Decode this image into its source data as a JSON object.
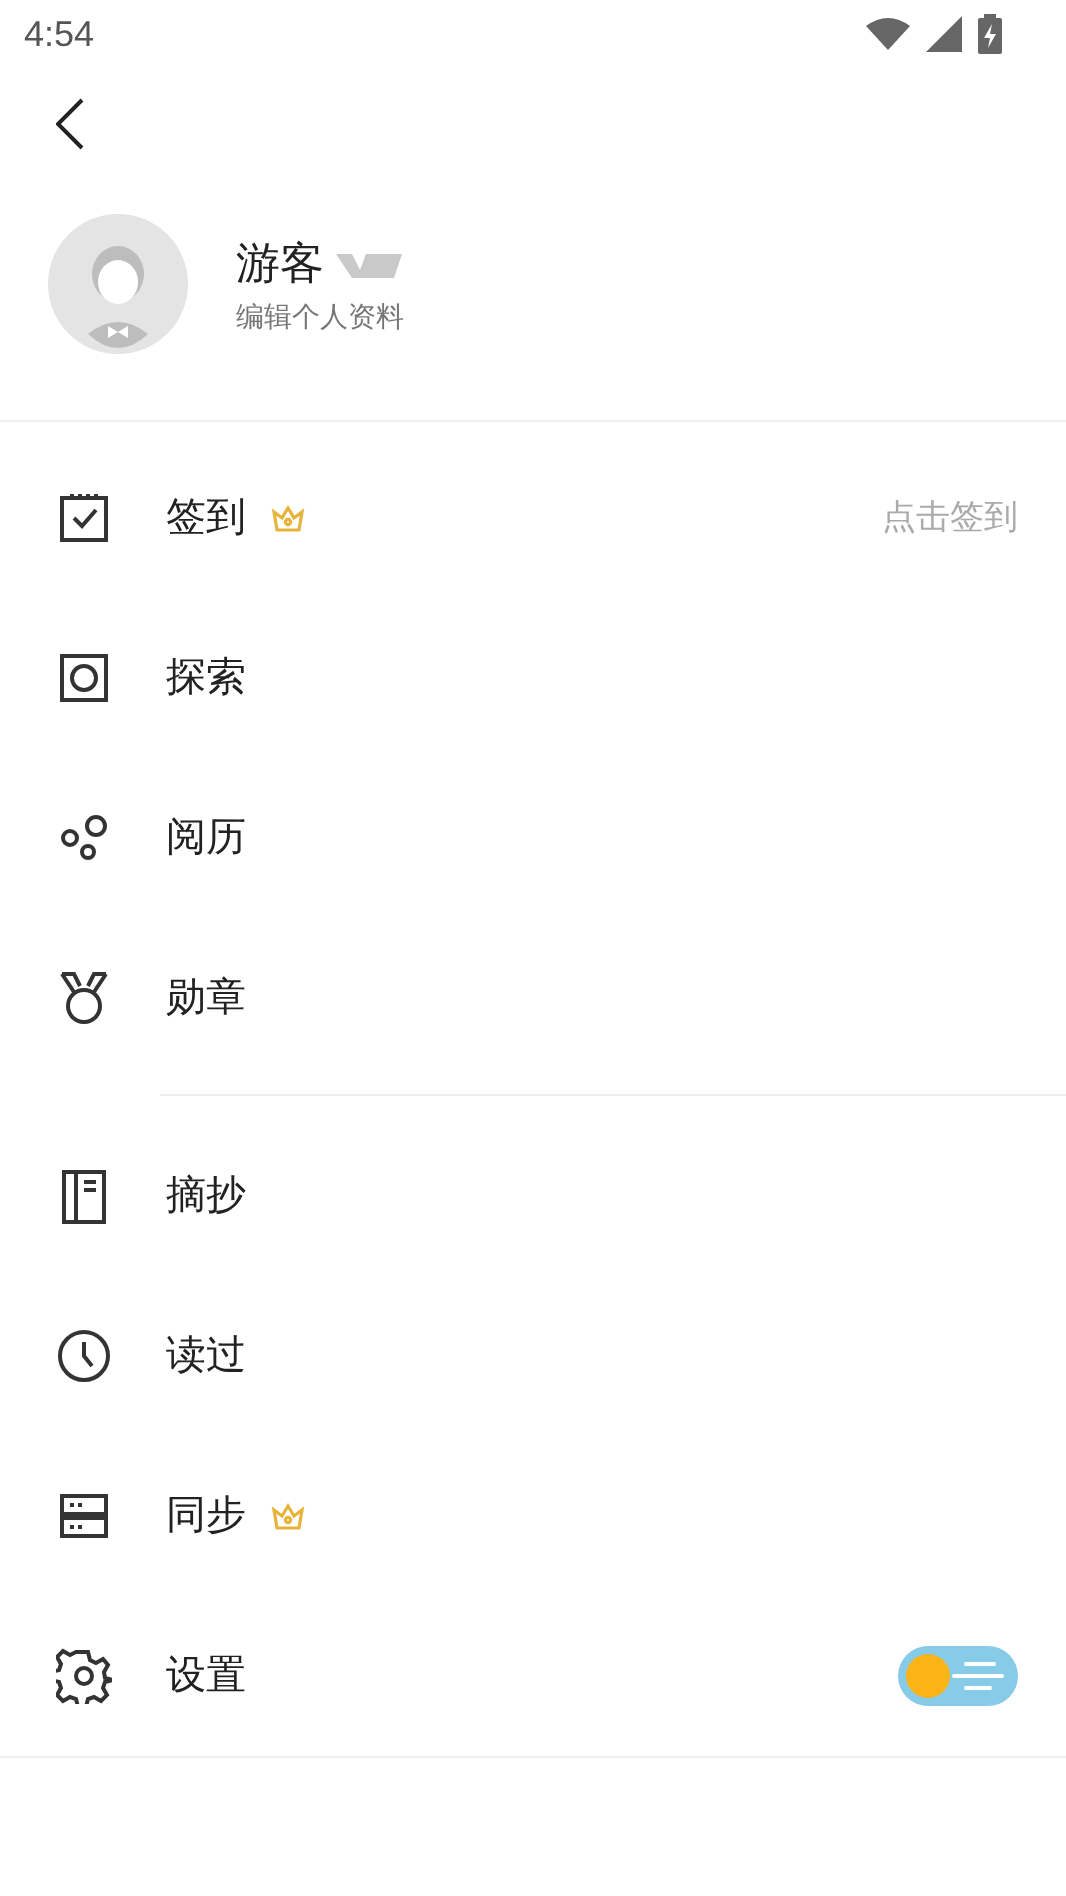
{
  "status_bar": {
    "time": "4:54"
  },
  "profile": {
    "name": "游客",
    "subtitle": "编辑个人资料"
  },
  "sections": [
    {
      "items": [
        {
          "label": "签到",
          "vip": true,
          "hint": "点击签到"
        },
        {
          "label": "探索",
          "vip": false
        },
        {
          "label": "阅历",
          "vip": false
        },
        {
          "label": "勋章",
          "vip": false
        }
      ]
    },
    {
      "items": [
        {
          "label": "摘抄",
          "vip": false
        },
        {
          "label": "读过",
          "vip": false
        },
        {
          "label": "同步",
          "vip": true
        },
        {
          "label": "设置",
          "vip": false,
          "kind": "theme_switch",
          "on": false
        }
      ]
    }
  ]
}
